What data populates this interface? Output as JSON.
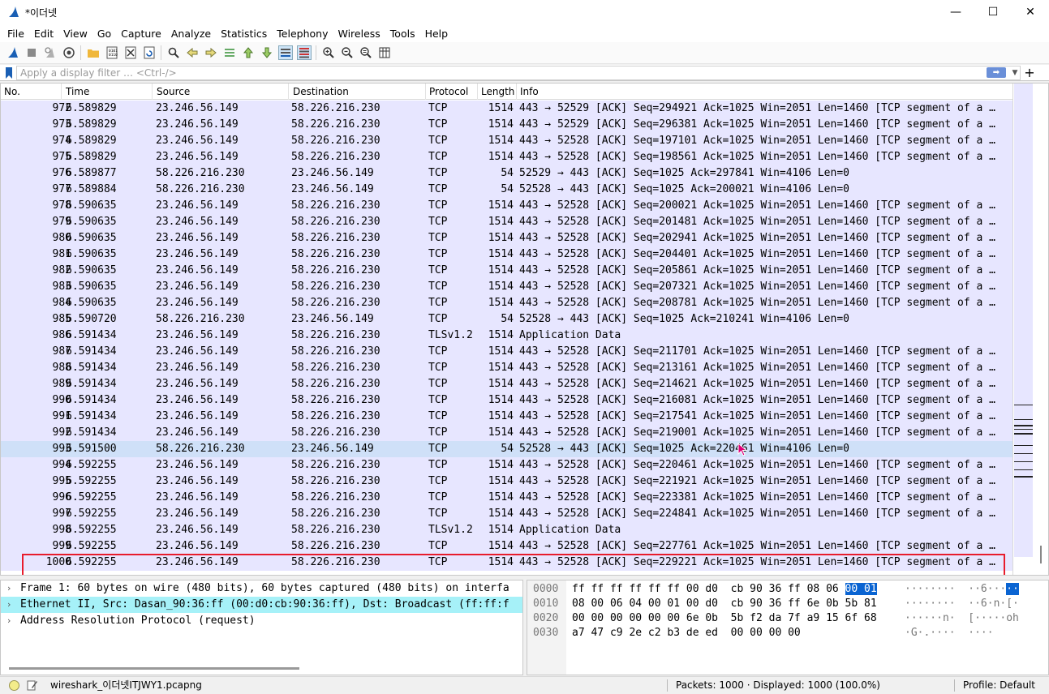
{
  "window": {
    "title": "*이더넷",
    "minimize": "—",
    "maximize": "☐",
    "close": "✕"
  },
  "menu": [
    "File",
    "Edit",
    "View",
    "Go",
    "Capture",
    "Analyze",
    "Statistics",
    "Telephony",
    "Wireless",
    "Tools",
    "Help"
  ],
  "filter": {
    "placeholder": "Apply a display filter … <Ctrl-/>",
    "apply_icon": "arrow-right-icon",
    "add_label": "+"
  },
  "packet_list": {
    "columns": [
      "No.",
      "Time",
      "Source",
      "Destination",
      "Protocol",
      "Length",
      "Info"
    ],
    "rows": [
      [
        "972",
        "6.589829",
        "23.246.56.149",
        "58.226.216.230",
        "TCP",
        "1514",
        "443 → 52529 [ACK] Seq=294921 Ack=1025 Win=2051 Len=1460 [TCP segment of a …"
      ],
      [
        "973",
        "6.589829",
        "23.246.56.149",
        "58.226.216.230",
        "TCP",
        "1514",
        "443 → 52529 [ACK] Seq=296381 Ack=1025 Win=2051 Len=1460 [TCP segment of a …"
      ],
      [
        "974",
        "6.589829",
        "23.246.56.149",
        "58.226.216.230",
        "TCP",
        "1514",
        "443 → 52528 [ACK] Seq=197101 Ack=1025 Win=2051 Len=1460 [TCP segment of a …"
      ],
      [
        "975",
        "6.589829",
        "23.246.56.149",
        "58.226.216.230",
        "TCP",
        "1514",
        "443 → 52528 [ACK] Seq=198561 Ack=1025 Win=2051 Len=1460 [TCP segment of a …"
      ],
      [
        "976",
        "6.589877",
        "58.226.216.230",
        "23.246.56.149",
        "TCP",
        "54",
        "52529 → 443 [ACK] Seq=1025 Ack=297841 Win=4106 Len=0"
      ],
      [
        "977",
        "6.589884",
        "58.226.216.230",
        "23.246.56.149",
        "TCP",
        "54",
        "52528 → 443 [ACK] Seq=1025 Ack=200021 Win=4106 Len=0"
      ],
      [
        "978",
        "6.590635",
        "23.246.56.149",
        "58.226.216.230",
        "TCP",
        "1514",
        "443 → 52528 [ACK] Seq=200021 Ack=1025 Win=2051 Len=1460 [TCP segment of a …"
      ],
      [
        "979",
        "6.590635",
        "23.246.56.149",
        "58.226.216.230",
        "TCP",
        "1514",
        "443 → 52528 [ACK] Seq=201481 Ack=1025 Win=2051 Len=1460 [TCP segment of a …"
      ],
      [
        "980",
        "6.590635",
        "23.246.56.149",
        "58.226.216.230",
        "TCP",
        "1514",
        "443 → 52528 [ACK] Seq=202941 Ack=1025 Win=2051 Len=1460 [TCP segment of a …"
      ],
      [
        "981",
        "6.590635",
        "23.246.56.149",
        "58.226.216.230",
        "TCP",
        "1514",
        "443 → 52528 [ACK] Seq=204401 Ack=1025 Win=2051 Len=1460 [TCP segment of a …"
      ],
      [
        "982",
        "6.590635",
        "23.246.56.149",
        "58.226.216.230",
        "TCP",
        "1514",
        "443 → 52528 [ACK] Seq=205861 Ack=1025 Win=2051 Len=1460 [TCP segment of a …"
      ],
      [
        "983",
        "6.590635",
        "23.246.56.149",
        "58.226.216.230",
        "TCP",
        "1514",
        "443 → 52528 [ACK] Seq=207321 Ack=1025 Win=2051 Len=1460 [TCP segment of a …"
      ],
      [
        "984",
        "6.590635",
        "23.246.56.149",
        "58.226.216.230",
        "TCP",
        "1514",
        "443 → 52528 [ACK] Seq=208781 Ack=1025 Win=2051 Len=1460 [TCP segment of a …"
      ],
      [
        "985",
        "6.590720",
        "58.226.216.230",
        "23.246.56.149",
        "TCP",
        "54",
        "52528 → 443 [ACK] Seq=1025 Ack=210241 Win=4106 Len=0"
      ],
      [
        "986",
        "6.591434",
        "23.246.56.149",
        "58.226.216.230",
        "TLSv1.2",
        "1514",
        "Application Data"
      ],
      [
        "987",
        "6.591434",
        "23.246.56.149",
        "58.226.216.230",
        "TCP",
        "1514",
        "443 → 52528 [ACK] Seq=211701 Ack=1025 Win=2051 Len=1460 [TCP segment of a …"
      ],
      [
        "988",
        "6.591434",
        "23.246.56.149",
        "58.226.216.230",
        "TCP",
        "1514",
        "443 → 52528 [ACK] Seq=213161 Ack=1025 Win=2051 Len=1460 [TCP segment of a …"
      ],
      [
        "989",
        "6.591434",
        "23.246.56.149",
        "58.226.216.230",
        "TCP",
        "1514",
        "443 → 52528 [ACK] Seq=214621 Ack=1025 Win=2051 Len=1460 [TCP segment of a …"
      ],
      [
        "990",
        "6.591434",
        "23.246.56.149",
        "58.226.216.230",
        "TCP",
        "1514",
        "443 → 52528 [ACK] Seq=216081 Ack=1025 Win=2051 Len=1460 [TCP segment of a …"
      ],
      [
        "991",
        "6.591434",
        "23.246.56.149",
        "58.226.216.230",
        "TCP",
        "1514",
        "443 → 52528 [ACK] Seq=217541 Ack=1025 Win=2051 Len=1460 [TCP segment of a …"
      ],
      [
        "992",
        "6.591434",
        "23.246.56.149",
        "58.226.216.230",
        "TCP",
        "1514",
        "443 → 52528 [ACK] Seq=219001 Ack=1025 Win=2051 Len=1460 [TCP segment of a …"
      ],
      [
        "993",
        "6.591500",
        "58.226.216.230",
        "23.246.56.149",
        "TCP",
        "54",
        "52528 → 443 [ACK] Seq=1025 Ack=220461 Win=4106 Len=0"
      ],
      [
        "994",
        "6.592255",
        "23.246.56.149",
        "58.226.216.230",
        "TCP",
        "1514",
        "443 → 52528 [ACK] Seq=220461 Ack=1025 Win=2051 Len=1460 [TCP segment of a …"
      ],
      [
        "995",
        "6.592255",
        "23.246.56.149",
        "58.226.216.230",
        "TCP",
        "1514",
        "443 → 52528 [ACK] Seq=221921 Ack=1025 Win=2051 Len=1460 [TCP segment of a …"
      ],
      [
        "996",
        "6.592255",
        "23.246.56.149",
        "58.226.216.230",
        "TCP",
        "1514",
        "443 → 52528 [ACK] Seq=223381 Ack=1025 Win=2051 Len=1460 [TCP segment of a …"
      ],
      [
        "997",
        "6.592255",
        "23.246.56.149",
        "58.226.216.230",
        "TCP",
        "1514",
        "443 → 52528 [ACK] Seq=224841 Ack=1025 Win=2051 Len=1460 [TCP segment of a …"
      ],
      [
        "998",
        "6.592255",
        "23.246.56.149",
        "58.226.216.230",
        "TLSv1.2",
        "1514",
        "Application Data"
      ],
      [
        "999",
        "6.592255",
        "23.246.56.149",
        "58.226.216.230",
        "TCP",
        "1514",
        "443 → 52528 [ACK] Seq=227761 Ack=1025 Win=2051 Len=1460 [TCP segment of a …"
      ],
      [
        "1000",
        "6.592255",
        "23.246.56.149",
        "58.226.216.230",
        "TCP",
        "1514",
        "443 → 52528 [ACK] Seq=229221 Ack=1025 Win=2051 Len=1460 [TCP segment of a …"
      ]
    ],
    "selected_row": "993",
    "highlighted_row": "1000",
    "row_color": "#e7e6ff",
    "selected_color": "#cfe0f8",
    "highlight_box_color": "#e81c2c"
  },
  "detail_pane": {
    "items": [
      "Frame 1: 60 bytes on wire (480 bits), 60 bytes captured (480 bits) on interfa",
      "Ethernet II, Src: Dasan_90:36:ff (00:d0:cb:90:36:ff), Dst: Broadcast (ff:ff:f",
      "Address Resolution Protocol (request)"
    ],
    "expand_icon": "chevron-right-icon",
    "highlight_color": "#a6f1f8"
  },
  "bytes_pane": {
    "offsets": [
      "0000",
      "0010",
      "0020",
      "0030"
    ],
    "hex_lines": [
      [
        "ff ff ff ff ff ff 00 d0  cb 90 36 ff 08 06 ",
        "00 01"
      ],
      [
        "08 00 06 04 00 01 00 d0  cb 90 36 ff 6e 0b 5b 81",
        ""
      ],
      [
        "00 00 00 00 00 00 6e 0b  5b f2 da 7f a9 15 6f 68",
        ""
      ],
      [
        "a7 47 c9 2e c2 b3 de ed  00 00 00 00",
        ""
      ]
    ],
    "ascii_lines": [
      [
        "········  ··6···",
        "··"
      ],
      [
        "········  ··6·n·[·",
        ""
      ],
      [
        "······n·  [·····oh",
        ""
      ],
      [
        "·G·.····  ····",
        ""
      ]
    ],
    "highlight_color": "#0a64d2"
  },
  "status": {
    "file": "wireshark_이더넷ITJWY1.pcapng",
    "packets": "Packets: 1000 · Displayed: 1000 (100.0%)",
    "profile": "Profile: Default"
  }
}
